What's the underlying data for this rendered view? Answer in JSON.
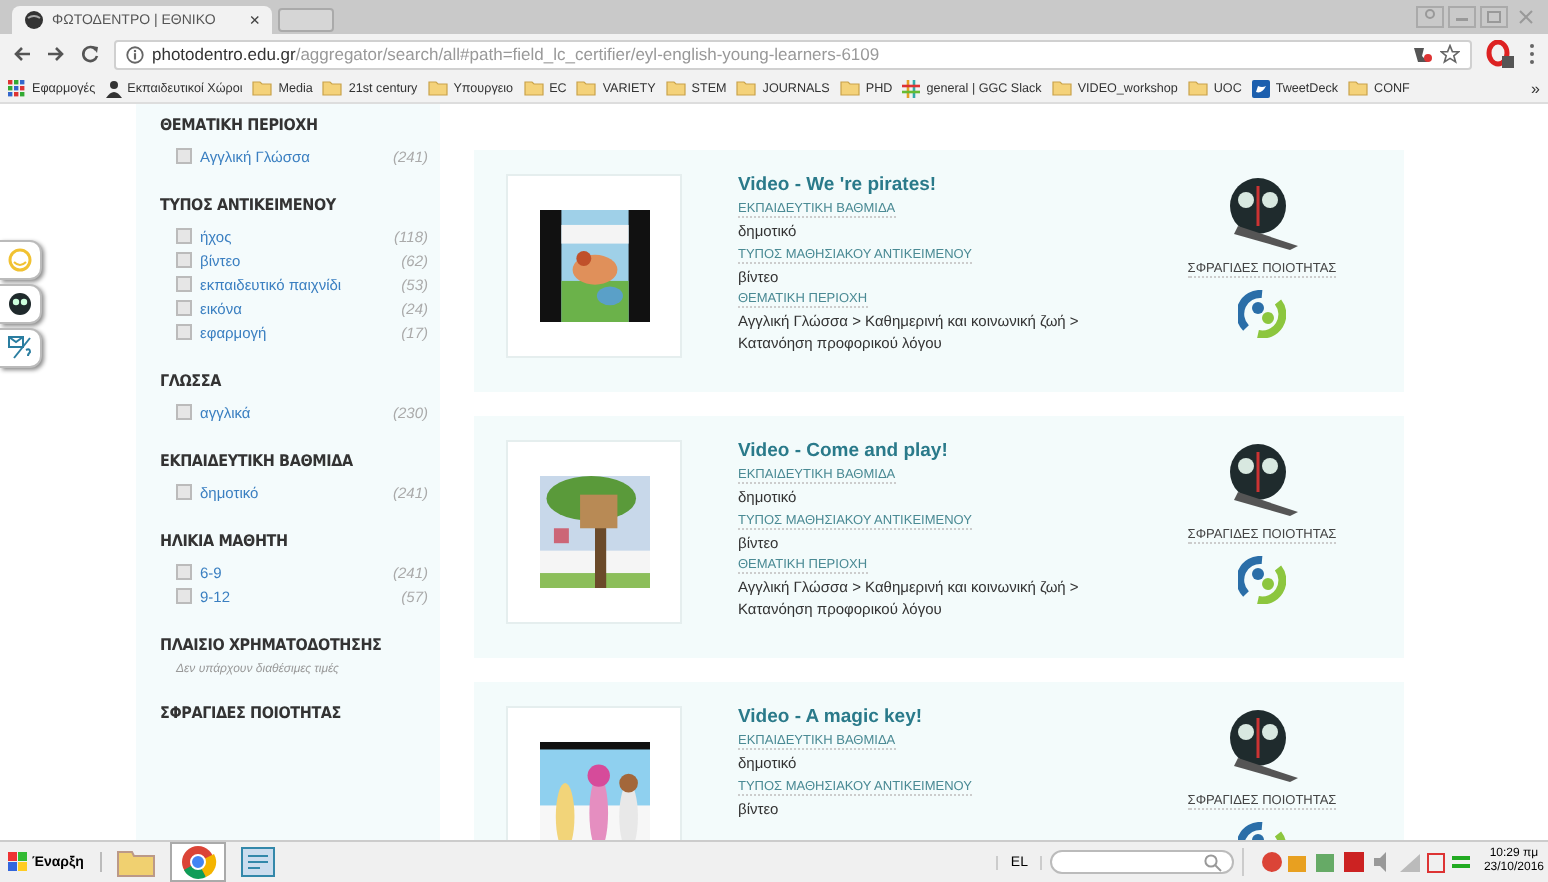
{
  "browser": {
    "tab": {
      "title": "ΦΩΤΟΔΕΝΤΡΟ | ΕΘΝΙΚΟ",
      "close": "×"
    },
    "url": {
      "host": "photodentro.edu.gr",
      "path": "/aggregator/search/all#path=field_lc_certifier/eyl-english-young-learners-6109"
    },
    "bookmarks": [
      {
        "label": "Εφαρμογές",
        "kind": "apps"
      },
      {
        "label": "Εκπαιδευτικοί Χώροι",
        "kind": "person"
      },
      {
        "label": "Media",
        "kind": "folder"
      },
      {
        "label": "21st century",
        "kind": "folder"
      },
      {
        "label": "Υπουργειο",
        "kind": "folder"
      },
      {
        "label": "EC",
        "kind": "folder"
      },
      {
        "label": "VARIETY",
        "kind": "folder"
      },
      {
        "label": "STEM",
        "kind": "folder"
      },
      {
        "label": "JOURNALS",
        "kind": "folder"
      },
      {
        "label": "PHD",
        "kind": "folder"
      },
      {
        "label": "general | GGC Slack",
        "kind": "slack"
      },
      {
        "label": "VIDEO_workshop",
        "kind": "folder"
      },
      {
        "label": "UOC",
        "kind": "folder"
      },
      {
        "label": "TweetDeck",
        "kind": "tweetdeck"
      },
      {
        "label": "CONF",
        "kind": "folder"
      }
    ],
    "bookmarks_more": "»"
  },
  "sidebar": {
    "facets": [
      {
        "title": "ΘΕΜΑΤΙΚΗ ΠΕΡΙΟΧΗ",
        "items": [
          {
            "label": "Αγγλική Γλώσσα",
            "count": "(241)",
            "checked": false
          }
        ]
      },
      {
        "title": "ΤΥΠΟΣ ΑΝΤΙΚΕΙΜΕΝΟΥ",
        "items": [
          {
            "label": "ήχος",
            "count": "(118)",
            "checked": false
          },
          {
            "label": "βίντεο",
            "count": "(62)",
            "checked": false
          },
          {
            "label": "εκπαιδευτικό παιχνίδι",
            "count": "(53)",
            "checked": false
          },
          {
            "label": "εικόνα",
            "count": "(24)",
            "checked": false
          },
          {
            "label": "εφαρμογή",
            "count": "(17)",
            "checked": false
          }
        ]
      },
      {
        "title": "ΓΛΩΣΣΑ",
        "items": [
          {
            "label": "αγγλικά",
            "count": "(230)",
            "checked": false
          }
        ]
      },
      {
        "title": "ΕΚΠΑΙΔΕΥΤΙΚΗ ΒΑΘΜΙΔΑ",
        "items": [
          {
            "label": "δημοτικό",
            "count": "(241)",
            "checked": false
          }
        ]
      },
      {
        "title": "ΗΛΙΚΙΑ ΜΑΘΗΤΗ",
        "items": [
          {
            "label": "6-9",
            "count": "(241)",
            "checked": false
          },
          {
            "label": "9-12",
            "count": "(57)",
            "checked": false
          }
        ]
      },
      {
        "title": "ΠΛΑΙΣΙΟ ΧΡΗΜΑΤΟΔΟΤΗΣΗΣ",
        "note": "Δεν υπάρχουν διαθέσιμες τιμές"
      },
      {
        "title": "ΣΦΡΑΓΙΔΕΣ ΠΟΙΟΤΗΤΑΣ"
      }
    ]
  },
  "results": [
    {
      "title": "Video - We 're pirates!",
      "fields": [
        {
          "label": "ΕΚΠΑΙΔΕΥΤΙΚΗ ΒΑΘΜΙΔΑ",
          "value": "δημοτικό"
        },
        {
          "label": "ΤΥΠΟΣ ΜΑΘΗΣΙΑΚΟΥ ΑΝΤΙΚΕΙΜΕΝΟΥ",
          "value": "βίντεο"
        },
        {
          "label": "ΘΕΜΑΤΙΚΗ ΠΕΡΙΟΧΗ",
          "value": "Αγγλική Γλώσσα > Καθημερινή και κοινωνική ζωή > Κατανόηση προφορικού λόγου"
        }
      ],
      "seals_label": "ΣΦΡΑΓΙΔΕΣ ΠΟΙΟΤΗΤΑΣ"
    },
    {
      "title": "Video - Come and play!",
      "fields": [
        {
          "label": "ΕΚΠΑΙΔΕΥΤΙΚΗ ΒΑΘΜΙΔΑ",
          "value": "δημοτικό"
        },
        {
          "label": "ΤΥΠΟΣ ΜΑΘΗΣΙΑΚΟΥ ΑΝΤΙΚΕΙΜΕΝΟΥ",
          "value": "βίντεο"
        },
        {
          "label": "ΘΕΜΑΤΙΚΗ ΠΕΡΙΟΧΗ",
          "value": "Αγγλική Γλώσσα > Καθημερινή και κοινωνική ζωή > Κατανόηση προφορικού λόγου"
        }
      ],
      "seals_label": "ΣΦΡΑΓΙΔΕΣ ΠΟΙΟΤΗΤΑΣ"
    },
    {
      "title": "Video - A magic key!",
      "fields": [
        {
          "label": "ΕΚΠΑΙΔΕΥΤΙΚΗ ΒΑΘΜΙΔΑ",
          "value": "δημοτικό"
        },
        {
          "label": "ΤΥΠΟΣ ΜΑΘΗΣΙΑΚΟΥ ΑΝΤΙΚΕΙΜΕΝΟΥ",
          "value": "βίντεο"
        }
      ],
      "seals_label": "ΣΦΡΑΓΙΔΕΣ ΠΟΙΟΤΗΤΑΣ"
    }
  ],
  "taskbar": {
    "start": "Έναρξη",
    "language": "EL",
    "time": "10:29 πμ",
    "date": "23/10/2016"
  }
}
